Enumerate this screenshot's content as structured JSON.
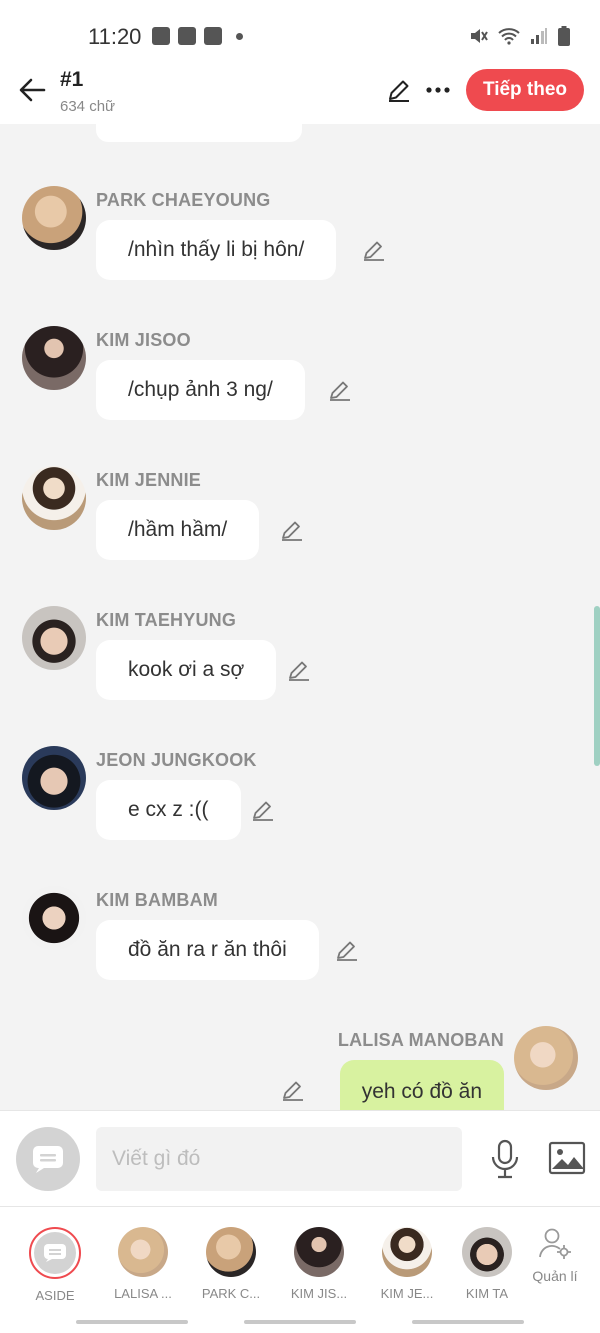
{
  "status_bar": {
    "time": "11:20"
  },
  "header": {
    "title": "#1",
    "subtitle": "634 chữ",
    "next_label": "Tiếp theo"
  },
  "messages": [
    {
      "sender": "PARK CHAEYOUNG",
      "text": "/nhìn thấy li bị hôn/",
      "avatar_color": "#c9a27a"
    },
    {
      "sender": "KIM JISOO",
      "text": "/chụp ảnh 3 ng/",
      "avatar_color": "#4a3a3a"
    },
    {
      "sender": "KIM JENNIE",
      "text": "/hầm hầm/",
      "avatar_color": "#b99a78"
    },
    {
      "sender": "KIM TAEHYUNG",
      "text": "kook ơi a sợ",
      "avatar_color": "#8a6f6a"
    },
    {
      "sender": "JEON JUNGKOOK",
      "text": "e cx z :((",
      "avatar_color": "#2a3040"
    },
    {
      "sender": "KIM BAMBAM",
      "text": "đồ ăn ra r ăn thôi",
      "avatar_color": "#3a3030"
    }
  ],
  "my_message": {
    "sender": "LALISA MANOBAN",
    "text": "yeh có đồ ăn",
    "avatar_color": "#d8b898"
  },
  "input": {
    "placeholder": "Viết gì đó"
  },
  "characters": [
    {
      "name": "ASIDE"
    },
    {
      "name": "LALISA ...",
      "color": "#d8b898"
    },
    {
      "name": "PARK C...",
      "color": "#c9a27a"
    },
    {
      "name": "KIM JIS...",
      "color": "#4a3a3a"
    },
    {
      "name": "KIM JE...",
      "color": "#b99a78"
    },
    {
      "name": "KIM TA",
      "color": "#8a6f6a"
    }
  ],
  "manage_label": "Quản lí",
  "colors": {
    "accent": "#ef4a4f",
    "my_bubble": "#d8f2a0",
    "chat_bg": "#f3f3f3"
  }
}
